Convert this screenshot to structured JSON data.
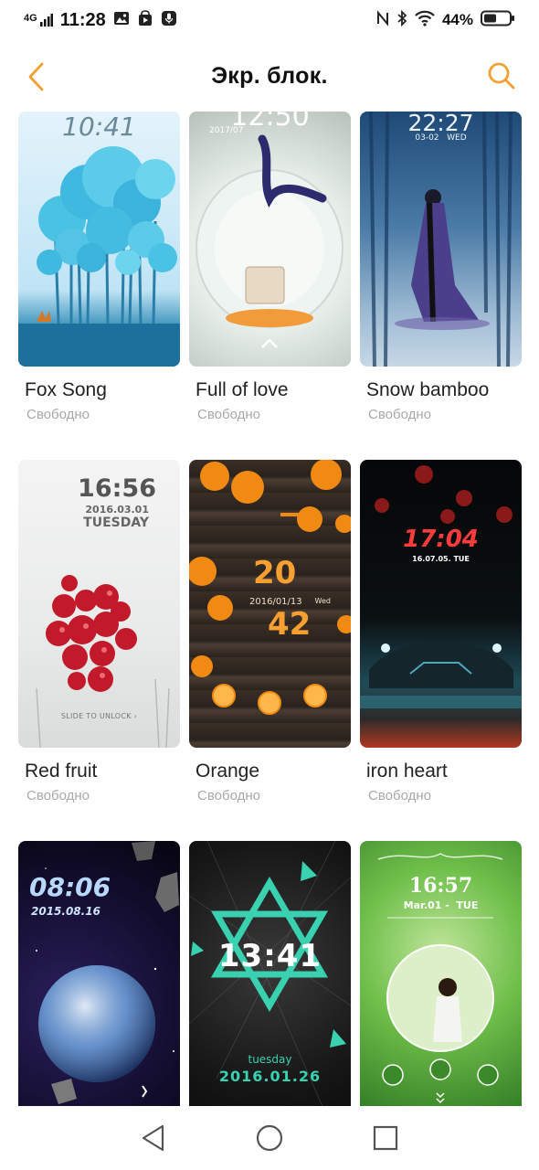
{
  "status_bar": {
    "network": "4G",
    "time": "11:28",
    "battery": "44%"
  },
  "header": {
    "title": "Экр. блок."
  },
  "colors": {
    "accent": "#f0a030"
  },
  "themes": [
    {
      "name": "Fox Song",
      "price": "Свободно",
      "clock": "10:41",
      "date": ""
    },
    {
      "name": "Full of love",
      "price": "Свободно",
      "clock": "12:50",
      "date": "2017/07"
    },
    {
      "name": "Snow bamboo",
      "price": "Свободно",
      "clock": "22:27",
      "date": "03-02   WED"
    },
    {
      "name": "Red fruit",
      "price": "Свободно",
      "clock": "16:56",
      "date": "2016.03.01",
      "day": "TUESDAY",
      "hint": "SLIDE TO UNLOCK ›"
    },
    {
      "name": "Orange",
      "price": "Свободно",
      "clock": "20",
      "clock2": "42",
      "date": "2016/01/13",
      "day": "Wed"
    },
    {
      "name": "iron heart",
      "price": "Свободно",
      "clock": "17:04",
      "date": "16.07.05. TUE"
    },
    {
      "name": "",
      "price": "",
      "clock": "08:06",
      "date": "2015.08.16"
    },
    {
      "name": "",
      "price": "",
      "clock": "13:41",
      "date": "2016.01.26",
      "day": "tuesday"
    },
    {
      "name": "",
      "price": "",
      "clock": "16:57",
      "date": "Mar.01 -  TUE"
    }
  ],
  "icons": {
    "back": "back-arrow-icon",
    "search": "search-icon",
    "nav_back": "triangle-back-icon",
    "nav_home": "circle-home-icon",
    "nav_recent": "square-recent-icon"
  }
}
